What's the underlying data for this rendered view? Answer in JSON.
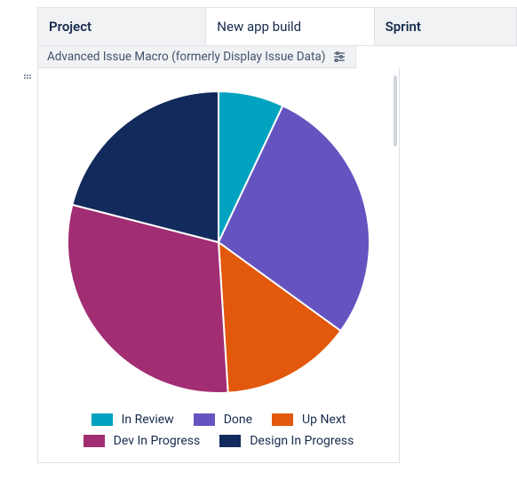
{
  "header": {
    "project_label": "Project",
    "project_value": "New app build",
    "sprint_label": "Sprint"
  },
  "macro_bar": {
    "label": "Advanced Issue Macro (formerly Display Issue Data)"
  },
  "chart_data": {
    "type": "pie",
    "title": "",
    "series": [
      {
        "name": "In Review",
        "value": 7,
        "color": "#00A3BF"
      },
      {
        "name": "Done",
        "value": 28,
        "color": "#6554C0"
      },
      {
        "name": "Up Next",
        "value": 14,
        "color": "#E2580C"
      },
      {
        "name": "Dev In Progress",
        "value": 30,
        "color": "#A12D72"
      },
      {
        "name": "Design In Progress",
        "value": 21,
        "color": "#122A5C"
      }
    ]
  },
  "legend": {
    "items": [
      {
        "label": "In Review",
        "color": "#00A3BF"
      },
      {
        "label": "Done",
        "color": "#6554C0"
      },
      {
        "label": "Up Next",
        "color": "#E2580C"
      },
      {
        "label": "Dev In Progress",
        "color": "#A12D72"
      },
      {
        "label": "Design In Progress",
        "color": "#122A5C"
      }
    ]
  }
}
